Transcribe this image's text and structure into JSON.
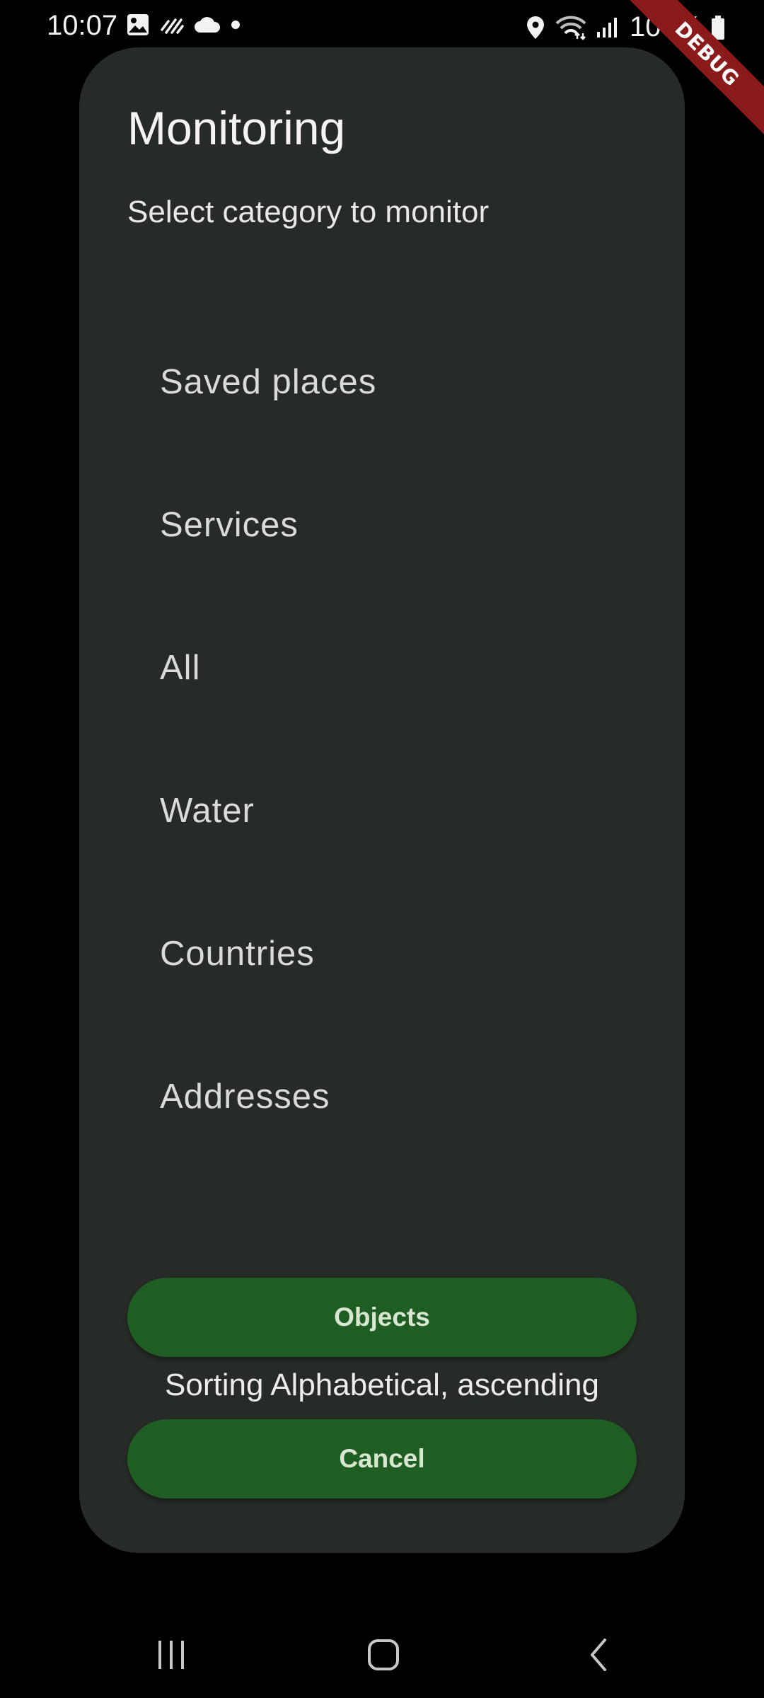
{
  "status_bar": {
    "time": "10:07",
    "left_icons": [
      "gallery-icon",
      "activity-icon",
      "cloud-icon",
      "dot-icon"
    ],
    "right_icons": [
      "location-icon",
      "wifi-icon",
      "signal-icon"
    ],
    "battery": "100%"
  },
  "debug_banner": "DEBUG",
  "dialog": {
    "title": "Monitoring",
    "subtitle": "Select category to monitor",
    "categories": [
      {
        "label": "Saved places"
      },
      {
        "label": "Services"
      },
      {
        "label": "All"
      },
      {
        "label": "Water"
      },
      {
        "label": "Countries"
      },
      {
        "label": "Addresses"
      }
    ],
    "objects_button": "Objects",
    "sorting_text": "Sorting Alphabetical, ascending",
    "cancel_button": "Cancel"
  },
  "nav_bar": {
    "icons": [
      "recents-icon",
      "home-icon",
      "back-icon"
    ]
  },
  "colors": {
    "background": "#000000",
    "dialog": "#272b27",
    "button": "#1f5e22",
    "debug_ribbon": "#8b1a1a"
  }
}
